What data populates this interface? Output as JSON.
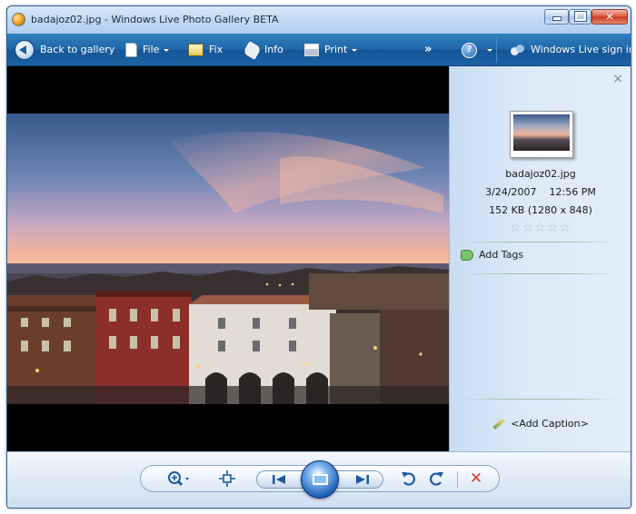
{
  "window": {
    "title": "badajoz02.jpg - Windows Live Photo Gallery BETA",
    "accent": "#1f67a8"
  },
  "toolbar": {
    "back_label": "Back to gallery",
    "file_label": "File",
    "fix_label": "Fix",
    "info_label": "Info",
    "print_label": "Print",
    "overflow_label": "»",
    "signin_label": "Windows Live sign in"
  },
  "photo": {
    "subject": "city skyline at sunset"
  },
  "info_pane": {
    "close_label": "×",
    "filename": "badajoz02.jpg",
    "date": "3/24/2007",
    "time": "12:56 PM",
    "size": "152 KB (1280 x 848)",
    "rating": 0,
    "rating_max": 5,
    "add_tags_label": "Add Tags",
    "add_caption_label": "<Add Caption>"
  },
  "controls": {
    "zoom_icon": "zoom-in-icon",
    "fit_icon": "actual-size-icon",
    "prev_icon": "previous-icon",
    "slideshow_icon": "slideshow-icon",
    "next_icon": "next-icon",
    "rotate_ccw_icon": "rotate-counterclockwise-icon",
    "rotate_cw_icon": "rotate-clockwise-icon",
    "delete_icon": "delete-icon"
  }
}
